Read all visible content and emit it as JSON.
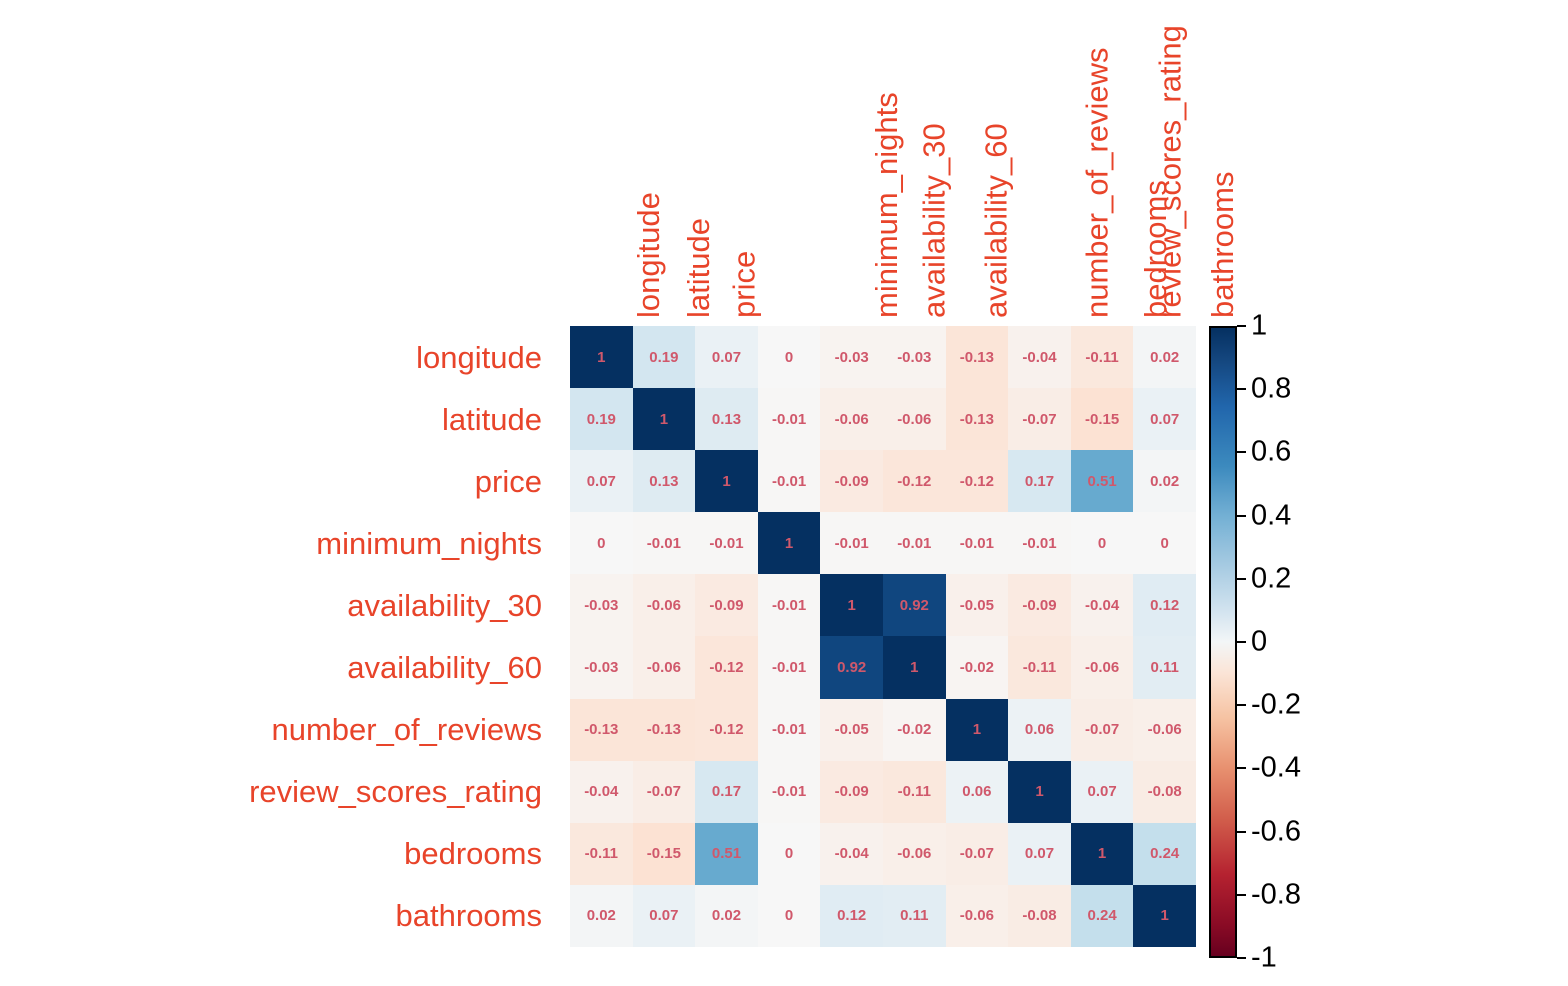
{
  "chart_data": {
    "type": "heatmap",
    "title": "",
    "xlabel": "",
    "ylabel": "",
    "colormap": "RdBu_r",
    "vmin": -1,
    "vmax": 1,
    "annotated": true,
    "grid": false,
    "legend_position": "right",
    "colorbar": {
      "ticks": [
        "1",
        "0.8",
        "0.6",
        "0.4",
        "0.2",
        "0",
        "-0.2",
        "-0.4",
        "-0.6",
        "-0.8",
        "-1"
      ],
      "tick_values": [
        1,
        0.8,
        0.6,
        0.4,
        0.2,
        0,
        -0.2,
        -0.4,
        -0.6,
        -0.8,
        -1
      ],
      "min_color": "#67001f",
      "mid_color": "#f7f7f7",
      "max_color": "#053061"
    },
    "x_tick_labels": [
      "longitude",
      "latitude",
      "price",
      "minimum_nights",
      "availability_30",
      "availability_60",
      "number_of_reviews",
      "review_scores_rating",
      "bedrooms",
      "bathrooms"
    ],
    "y_tick_labels": [
      "longitude",
      "latitude",
      "price",
      "minimum_nights",
      "availability_30",
      "availability_60",
      "number_of_reviews",
      "review_scores_rating",
      "bedrooms",
      "bathrooms"
    ],
    "values": [
      [
        1,
        0.19,
        0.07,
        0,
        -0.03,
        -0.03,
        -0.13,
        -0.04,
        -0.11,
        0.02
      ],
      [
        0.19,
        1,
        0.13,
        -0.01,
        -0.06,
        -0.06,
        -0.13,
        -0.07,
        -0.15,
        0.07
      ],
      [
        0.07,
        0.13,
        1,
        -0.01,
        -0.09,
        -0.12,
        -0.12,
        0.17,
        0.51,
        0.02
      ],
      [
        0,
        -0.01,
        -0.01,
        1,
        -0.01,
        -0.01,
        -0.01,
        -0.01,
        0,
        0
      ],
      [
        -0.03,
        -0.06,
        -0.09,
        -0.01,
        1,
        0.92,
        -0.05,
        -0.09,
        -0.04,
        0.12
      ],
      [
        -0.03,
        -0.06,
        -0.12,
        -0.01,
        0.92,
        1,
        -0.02,
        -0.11,
        -0.06,
        0.11
      ],
      [
        -0.13,
        -0.13,
        -0.12,
        -0.01,
        -0.05,
        -0.02,
        1,
        0.06,
        -0.07,
        -0.06
      ],
      [
        -0.04,
        -0.07,
        0.17,
        -0.01,
        -0.09,
        -0.11,
        0.06,
        1,
        0.07,
        -0.08
      ],
      [
        -0.11,
        -0.15,
        0.51,
        0,
        -0.04,
        -0.06,
        -0.07,
        0.07,
        1,
        0.24
      ],
      [
        0.02,
        0.07,
        0.02,
        0,
        0.12,
        0.11,
        -0.06,
        -0.08,
        0.24,
        1
      ]
    ],
    "labels": [
      [
        "1",
        "0.19",
        "0.07",
        "0",
        "-0.03",
        "-0.03",
        "-0.13",
        "-0.04",
        "-0.11",
        "0.02"
      ],
      [
        "0.19",
        "1",
        "0.13",
        "-0.01",
        "-0.06",
        "-0.06",
        "-0.13",
        "-0.07",
        "-0.15",
        "0.07"
      ],
      [
        "0.07",
        "0.13",
        "1",
        "-0.01",
        "-0.09",
        "-0.12",
        "-0.12",
        "0.17",
        "0.51",
        "0.02"
      ],
      [
        "0",
        "-0.01",
        "-0.01",
        "1",
        "-0.01",
        "-0.01",
        "-0.01",
        "-0.01",
        "0",
        "0"
      ],
      [
        "-0.03",
        "-0.06",
        "-0.09",
        "-0.01",
        "1",
        "0.92",
        "-0.05",
        "-0.09",
        "-0.04",
        "0.12"
      ],
      [
        "-0.03",
        "-0.06",
        "-0.12",
        "-0.01",
        "0.92",
        "1",
        "-0.02",
        "-0.11",
        "-0.06",
        "0.11"
      ],
      [
        "-0.13",
        "-0.13",
        "-0.12",
        "-0.01",
        "-0.05",
        "-0.02",
        "1",
        "0.06",
        "-0.07",
        "-0.06"
      ],
      [
        "-0.04",
        "-0.07",
        "0.17",
        "-0.01",
        "-0.09",
        "-0.11",
        "0.06",
        "1",
        "0.07",
        "-0.08"
      ],
      [
        "-0.11",
        "-0.15",
        "0.51",
        "0",
        "-0.04",
        "-0.06",
        "-0.07",
        "0.07",
        "1",
        "0.24"
      ],
      [
        "0.02",
        "0.07",
        "0.02",
        "0",
        "0.12",
        "0.11",
        "-0.06",
        "-0.08",
        "0.24",
        "1"
      ]
    ]
  },
  "style": {
    "tick_label_color": "#e8442a",
    "annotation_color": "#d0586b",
    "colorbar_label_color": "#000000",
    "background": "#ffffff"
  }
}
